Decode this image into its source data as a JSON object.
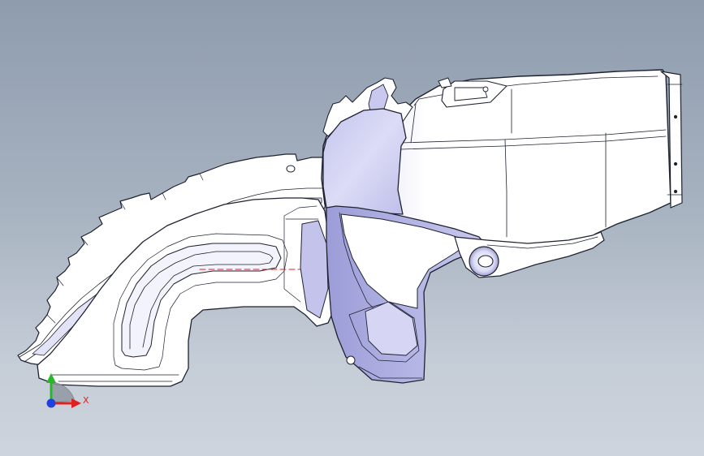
{
  "viewport": {
    "background_top": "#8e9cae",
    "background_bottom": "#cdd4dd",
    "model_outline": "#1f2230",
    "model_face_light": "#ffffff",
    "model_face_shade": "#c9c9ef",
    "model_face_dark": "#9d9ed8",
    "sketch_line_color": "#e02020"
  },
  "triad": {
    "x_label": "X",
    "x_color": "#e02020",
    "y_color": "#26b826",
    "z_color": "#2040e0",
    "icon": "coordinate-triad-icon"
  }
}
